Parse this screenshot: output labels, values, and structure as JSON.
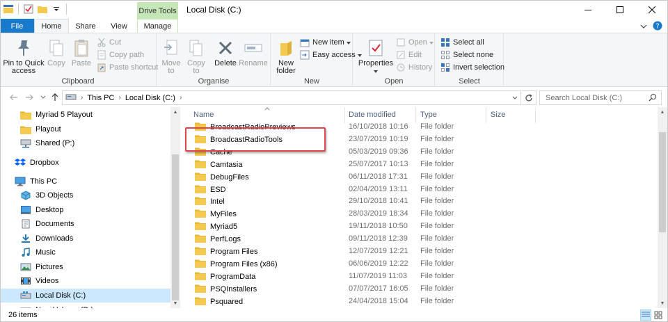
{
  "window": {
    "title": "Local Disk (C:)",
    "context_tab": "Drive Tools",
    "minimize_glyph": "–",
    "maximize_glyph": "☐",
    "close_glyph": "✕"
  },
  "ribbon_tabs": {
    "file": "File",
    "home": "Home",
    "share": "Share",
    "view": "View",
    "manage": "Manage"
  },
  "ribbon": {
    "clipboard": {
      "label": "Clipboard",
      "pin_line1": "Pin to Quick",
      "pin_line2": "access",
      "copy": "Copy",
      "paste": "Paste",
      "cut": "Cut",
      "copy_path": "Copy path",
      "paste_shortcut": "Paste shortcut"
    },
    "organise": {
      "label": "Organise",
      "move_to": "Move",
      "move_to2": "to",
      "copy_to": "Copy",
      "copy_to2": "to",
      "delete": "Delete",
      "rename": "Rename"
    },
    "new": {
      "label": "New",
      "new_folder1": "New",
      "new_folder2": "folder",
      "new_item": "New item",
      "easy_access": "Easy access"
    },
    "open": {
      "label": "Open",
      "properties": "Properties",
      "open": "Open",
      "edit": "Edit",
      "history": "History"
    },
    "select": {
      "label": "Select",
      "select_all": "Select all",
      "select_none": "Select none",
      "invert_selection": "Invert selection"
    }
  },
  "address": {
    "crumbs": [
      "This PC",
      "Local Disk (C:)"
    ],
    "search_placeholder": "Search Local Disk (C:)"
  },
  "nav_pane": {
    "items": [
      {
        "label": "Myriad 5 Playout",
        "icon": "folder-icon",
        "indent": 1
      },
      {
        "label": "Playout",
        "icon": "folder-icon",
        "indent": 1
      },
      {
        "label": "Shared (P:)",
        "icon": "network-drive-icon",
        "indent": 1
      },
      {
        "label": "Dropbox",
        "icon": "dropbox-icon",
        "indent": 0
      },
      {
        "label": "This PC",
        "icon": "computer-icon",
        "indent": 0
      },
      {
        "label": "3D Objects",
        "icon": "3d-objects-icon",
        "indent": 1
      },
      {
        "label": "Desktop",
        "icon": "desktop-icon",
        "indent": 1
      },
      {
        "label": "Documents",
        "icon": "documents-icon",
        "indent": 1
      },
      {
        "label": "Downloads",
        "icon": "downloads-icon",
        "indent": 1
      },
      {
        "label": "Music",
        "icon": "music-icon",
        "indent": 1
      },
      {
        "label": "Pictures",
        "icon": "pictures-icon",
        "indent": 1
      },
      {
        "label": "Videos",
        "icon": "videos-icon",
        "indent": 1
      },
      {
        "label": "Local Disk (C:)",
        "icon": "local-disk-icon",
        "indent": 1,
        "selected": true
      },
      {
        "label": "New Volume (D:)",
        "icon": "drive-icon",
        "indent": 1
      }
    ]
  },
  "file_list": {
    "columns": {
      "name": "Name",
      "date": "Date modified",
      "type": "Type",
      "size": "Size"
    },
    "rows": [
      {
        "name": "BroadcastRadioPreviews",
        "date": "16/10/2018 10:16",
        "type": "File folder"
      },
      {
        "name": "BroadcastRadioTools",
        "date": "23/07/2019 10:19",
        "type": "File folder"
      },
      {
        "name": "Cache",
        "date": "05/03/2019 09:36",
        "type": "File folder"
      },
      {
        "name": "Camtasia",
        "date": "25/07/2017 10:13",
        "type": "File folder"
      },
      {
        "name": "DebugFiles",
        "date": "06/11/2018 17:31",
        "type": "File folder"
      },
      {
        "name": "ESD",
        "date": "02/04/2019 13:11",
        "type": "File folder"
      },
      {
        "name": "Intel",
        "date": "29/10/2018 10:41",
        "type": "File folder"
      },
      {
        "name": "MyFiles",
        "date": "28/03/2019 18:34",
        "type": "File folder"
      },
      {
        "name": "Myriad5",
        "date": "19/11/2018 10:50",
        "type": "File folder"
      },
      {
        "name": "PerfLogs",
        "date": "09/11/2018 12:39",
        "type": "File folder"
      },
      {
        "name": "Program Files",
        "date": "12/07/2019 12:21",
        "type": "File folder"
      },
      {
        "name": "Program Files (x86)",
        "date": "06/06/2019 12:22",
        "type": "File folder"
      },
      {
        "name": "ProgramData",
        "date": "11/07/2019 11:03",
        "type": "File folder"
      },
      {
        "name": "PSQInstallers",
        "date": "07/07/2017 16:05",
        "type": "File folder"
      },
      {
        "name": "Psquared",
        "date": "24/04/2018 15:04",
        "type": "File folder"
      }
    ]
  },
  "status": {
    "item_count": "26 items"
  },
  "colors": {
    "file_tab": "#1979ca",
    "context_tab": "#c5e6b6",
    "selection": "#cce8ff",
    "folder": "#f3c94f",
    "highlight_box": "#e0474c"
  }
}
